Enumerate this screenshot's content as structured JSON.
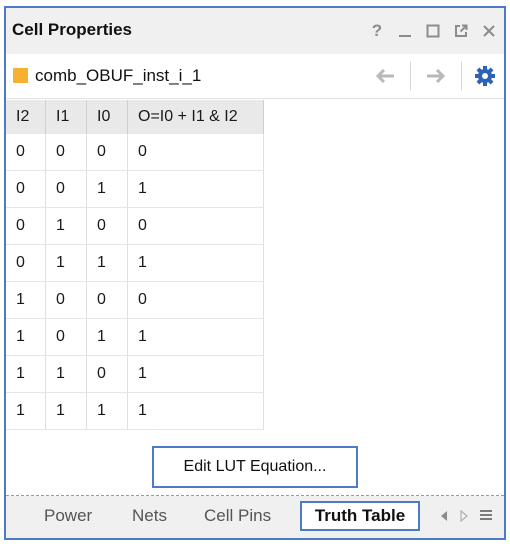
{
  "window": {
    "title": "Cell Properties"
  },
  "titlebar_icons": [
    "help-icon",
    "minimize-icon",
    "maximize-icon",
    "float-icon",
    "close-icon"
  ],
  "object": {
    "name": "comb_OBUF_inst_i_1",
    "swatch_color": "#f7b032"
  },
  "table": {
    "headers": [
      "I2",
      "I1",
      "I0",
      "O=I0 + I1 & I2"
    ],
    "rows": [
      [
        "0",
        "0",
        "0",
        "0"
      ],
      [
        "0",
        "0",
        "1",
        "1"
      ],
      [
        "0",
        "1",
        "0",
        "0"
      ],
      [
        "0",
        "1",
        "1",
        "1"
      ],
      [
        "1",
        "0",
        "0",
        "0"
      ],
      [
        "1",
        "0",
        "1",
        "1"
      ],
      [
        "1",
        "1",
        "0",
        "1"
      ],
      [
        "1",
        "1",
        "1",
        "1"
      ]
    ]
  },
  "edit_button": {
    "label": "Edit LUT Equation..."
  },
  "tabs": [
    {
      "label": "Power",
      "active": false
    },
    {
      "label": "Nets",
      "active": false
    },
    {
      "label": "Cell Pins",
      "active": false
    },
    {
      "label": "Truth Table",
      "active": true
    }
  ],
  "colors": {
    "accent": "#4a7cc9",
    "header_bg": "#f0f0f0",
    "gear": "#2b63b8"
  }
}
